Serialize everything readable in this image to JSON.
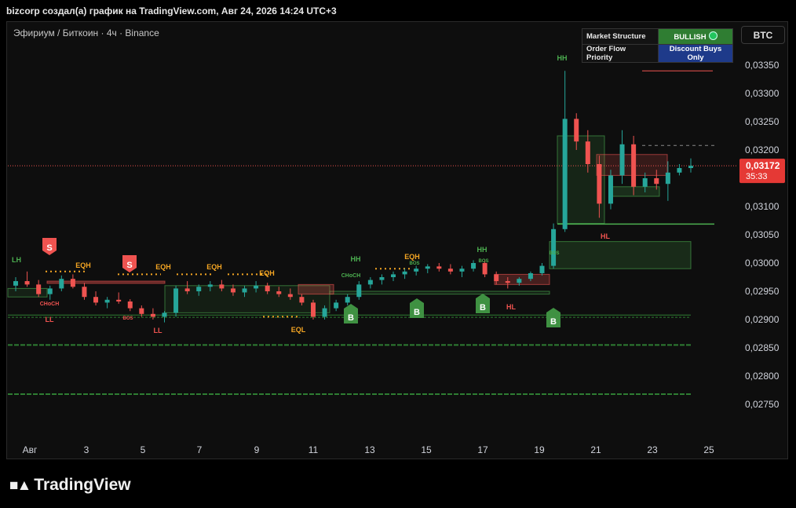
{
  "header": {
    "text": "bizcorp создал(а) график на TradingView.com, Авг 24, 2026 14:24 UTC+3"
  },
  "symbol": {
    "text": "Эфириум / Биткоин · 4ч · Binance"
  },
  "compare_button": {
    "label": "BTC"
  },
  "info_table": {
    "rows": [
      {
        "key": "Market Structure",
        "value": "BULLISH"
      },
      {
        "key": "Order Flow Priority",
        "value": "Discount Buys Only"
      }
    ]
  },
  "price_label": {
    "price": "0,03172",
    "countdown": "35:33"
  },
  "branding": {
    "name": "TradingView"
  },
  "colors": {
    "up": "#26a69a",
    "down": "#ef5350",
    "bull_badge": "#2f7d32",
    "priority_badge": "#1e3a8a",
    "price_tag": "#e53935"
  },
  "chart_data": {
    "type": "candlestick",
    "ylim": [
      0.0271,
      0.0338
    ],
    "y_ticks": [
      "0,03350",
      "0,03300",
      "0,03250",
      "0,03200",
      "0,03150",
      "0,03100",
      "0,03050",
      "0,03000",
      "0,02950",
      "0,02900",
      "0,02850",
      "0,02800",
      "0,02750"
    ],
    "x_ticks": [
      "Авг",
      "3",
      "5",
      "7",
      "9",
      "11",
      "13",
      "15",
      "17",
      "19",
      "21",
      "23",
      "25"
    ],
    "current_price": 0.03172,
    "candles": [
      [
        0.0296,
        0.02975,
        0.0295,
        0.02968
      ],
      [
        0.02968,
        0.02985,
        0.02958,
        0.02962
      ],
      [
        0.02962,
        0.0297,
        0.0294,
        0.02945
      ],
      [
        0.02945,
        0.0296,
        0.02935,
        0.02955
      ],
      [
        0.02955,
        0.02978,
        0.0295,
        0.02972
      ],
      [
        0.02972,
        0.0298,
        0.02955,
        0.02958
      ],
      [
        0.02958,
        0.02965,
        0.02935,
        0.0294
      ],
      [
        0.0294,
        0.0295,
        0.02925,
        0.0293
      ],
      [
        0.0293,
        0.0294,
        0.0292,
        0.02935
      ],
      [
        0.02935,
        0.02948,
        0.02928,
        0.02932
      ],
      [
        0.02932,
        0.02936,
        0.02915,
        0.0292
      ],
      [
        0.0292,
        0.02925,
        0.02905,
        0.0291
      ],
      [
        0.0291,
        0.0292,
        0.029,
        0.02905
      ],
      [
        0.02905,
        0.02915,
        0.02895,
        0.02912
      ],
      [
        0.02912,
        0.0296,
        0.02905,
        0.02955
      ],
      [
        0.02955,
        0.02968,
        0.02945,
        0.0295
      ],
      [
        0.0295,
        0.02962,
        0.02942,
        0.02958
      ],
      [
        0.02958,
        0.02968,
        0.0295,
        0.02962
      ],
      [
        0.02962,
        0.0297,
        0.0295,
        0.02955
      ],
      [
        0.02955,
        0.02962,
        0.02942,
        0.02948
      ],
      [
        0.02948,
        0.0296,
        0.0294,
        0.02955
      ],
      [
        0.02955,
        0.02968,
        0.02948,
        0.0296
      ],
      [
        0.0296,
        0.02965,
        0.02945,
        0.0295
      ],
      [
        0.0295,
        0.02958,
        0.0294,
        0.02945
      ],
      [
        0.02945,
        0.02955,
        0.02935,
        0.0294
      ],
      [
        0.0294,
        0.02945,
        0.02925,
        0.0293
      ],
      [
        0.0293,
        0.02935,
        0.029,
        0.02905
      ],
      [
        0.02905,
        0.02925,
        0.029,
        0.0292
      ],
      [
        0.0292,
        0.02935,
        0.02915,
        0.0293
      ],
      [
        0.0293,
        0.02945,
        0.02925,
        0.0294
      ],
      [
        0.0294,
        0.02968,
        0.02935,
        0.02962
      ],
      [
        0.02962,
        0.02975,
        0.02955,
        0.0297
      ],
      [
        0.0297,
        0.0298,
        0.02962,
        0.02975
      ],
      [
        0.02975,
        0.02985,
        0.02968,
        0.0298
      ],
      [
        0.0298,
        0.0299,
        0.02972,
        0.02985
      ],
      [
        0.02985,
        0.02995,
        0.02978,
        0.0299
      ],
      [
        0.0299,
        0.02998,
        0.02982,
        0.02994
      ],
      [
        0.02994,
        0.03,
        0.02985,
        0.0299
      ],
      [
        0.0299,
        0.02998,
        0.0298,
        0.02985
      ],
      [
        0.02985,
        0.02995,
        0.02975,
        0.0299
      ],
      [
        0.0299,
        0.03005,
        0.02985,
        0.03
      ],
      [
        0.03,
        0.03005,
        0.02975,
        0.0298
      ],
      [
        0.0298,
        0.02985,
        0.02962,
        0.02968
      ],
      [
        0.02968,
        0.02975,
        0.02955,
        0.02965
      ],
      [
        0.02965,
        0.02975,
        0.0296,
        0.02972
      ],
      [
        0.02972,
        0.02985,
        0.02968,
        0.02982
      ],
      [
        0.02982,
        0.03,
        0.02978,
        0.02995
      ],
      [
        0.02995,
        0.0307,
        0.0299,
        0.0306
      ],
      [
        0.0306,
        0.0334,
        0.03055,
        0.03255
      ],
      [
        0.03255,
        0.03265,
        0.032,
        0.03215
      ],
      [
        0.03215,
        0.03235,
        0.0316,
        0.03175
      ],
      [
        0.03175,
        0.0319,
        0.0308,
        0.03105
      ],
      [
        0.03105,
        0.03165,
        0.03095,
        0.03155
      ],
      [
        0.03155,
        0.03235,
        0.0314,
        0.0321
      ],
      [
        0.0321,
        0.03225,
        0.0312,
        0.03135
      ],
      [
        0.03135,
        0.0316,
        0.03125,
        0.0315
      ],
      [
        0.0315,
        0.03165,
        0.0313,
        0.0314
      ],
      [
        0.0314,
        0.0318,
        0.0311,
        0.0316
      ],
      [
        0.0316,
        0.03175,
        0.03155,
        0.03168
      ],
      [
        0.03168,
        0.03185,
        0.0316,
        0.03172
      ]
    ],
    "markers": [
      {
        "label": "S",
        "type": "sell"
      },
      {
        "label": "S",
        "type": "sell"
      },
      {
        "label": "B",
        "type": "buy"
      },
      {
        "label": "B",
        "type": "buy"
      },
      {
        "label": "B",
        "type": "buy"
      },
      {
        "label": "B",
        "type": "buy"
      }
    ],
    "annotations": [
      {
        "text": "LH",
        "color": "#4caf50"
      },
      {
        "text": "EQH",
        "color": "#f5a623"
      },
      {
        "text": "EQH",
        "color": "#f5a623"
      },
      {
        "text": "EQH",
        "color": "#f5a623"
      },
      {
        "text": "EQH",
        "color": "#f5a623"
      },
      {
        "text": "HH",
        "color": "#4caf50"
      },
      {
        "text": "EQH",
        "color": "#f5a623"
      },
      {
        "text": "HH",
        "color": "#4caf50"
      },
      {
        "text": "HH",
        "color": "#4caf50"
      },
      {
        "text": "LL",
        "color": "#ef5350"
      },
      {
        "text": "LL",
        "color": "#ef5350"
      },
      {
        "text": "EQL",
        "color": "#f5a623"
      },
      {
        "text": "HL",
        "color": "#ef5350"
      },
      {
        "text": "HL",
        "color": "#ef5350"
      },
      {
        "text": "CHoCH",
        "color": "#ef5350"
      },
      {
        "text": "CHoCH",
        "color": "#4caf50"
      },
      {
        "text": "BOS",
        "color": "#ef5350"
      },
      {
        "text": "BOS",
        "color": "#4caf50"
      },
      {
        "text": "BOS",
        "color": "#4caf50"
      },
      {
        "text": "BOS",
        "color": "#4caf50"
      }
    ]
  }
}
